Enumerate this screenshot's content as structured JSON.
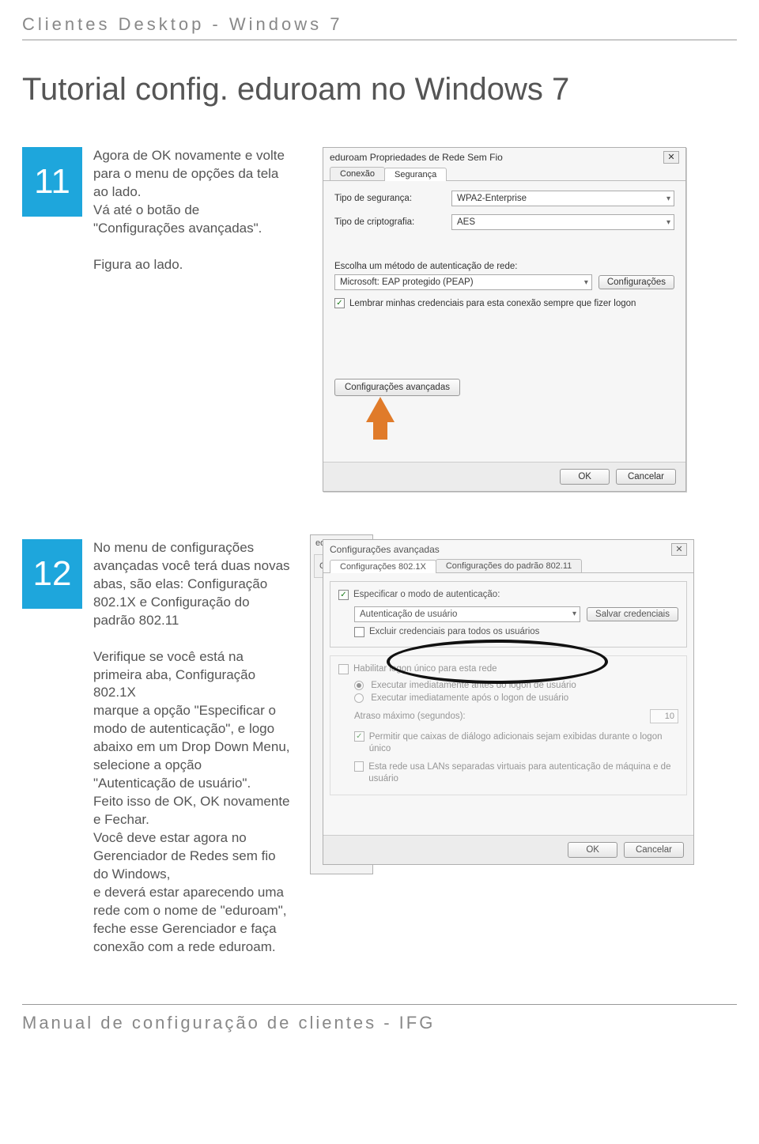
{
  "header": "Clientes Desktop - Windows 7",
  "title": "Tutorial config. eduroam no Windows 7",
  "step11": {
    "num": "11",
    "body": "Agora de OK novamente e volte para o menu de opções da tela ao lado.\nVá até o botão de \"Configurações avançadas\".\n\nFigura ao lado."
  },
  "dlg1": {
    "title": "eduroam Propriedades de Rede Sem Fio",
    "close": "✕",
    "tabs": {
      "conexao": "Conexão",
      "seguranca": "Segurança"
    },
    "tipo_seg_label": "Tipo de segurança:",
    "tipo_seg_value": "WPA2-Enterprise",
    "tipo_crip_label": "Tipo de criptografia:",
    "tipo_crip_value": "AES",
    "metodo_label": "Escolha um método de autenticação de rede:",
    "metodo_value": "Microsoft: EAP protegido (PEAP)",
    "config_btn": "Configurações",
    "lembrar": "Lembrar minhas credenciais para esta conexão sempre que fizer logon",
    "adv_btn": "Configurações avançadas",
    "ok": "OK",
    "cancel": "Cancelar"
  },
  "step12": {
    "num": "12",
    "body": "No menu de configurações avançadas você terá duas novas abas, são elas: Configuração 802.1X e Configuração do padrão 802.11\n\nVerifique se você está na primeira aba, Configuração 802.1X\nmarque a opção \"Especificar o modo de autenticação\", e logo abaixo em um Drop Down Menu, selecione a opção\n\"Autenticação de usuário\".\nFeito isso de OK, OK novamente e Fechar.\nVocê deve estar agora no Gerenciador de Redes sem fio do Windows,\ne deverá estar aparecendo uma rede com o nome de \"eduroam\",\nfeche esse Gerenciador e faça conexão com a rede eduroam."
  },
  "dlg2": {
    "behind_title": "edur",
    "behind_tab": "Configuraçã",
    "title": "Configurações avançadas",
    "tab1": "Configurações 802.1X",
    "tab2": "Configurações do padrão 802.11",
    "especificar": "Especificar o modo de autenticação:",
    "auth_value": "Autenticação de usuário",
    "salvar_cred": "Salvar credenciais",
    "excluir": "Excluir credenciais para todos os usuários",
    "habilitar": "Habilitar logon único para esta rede",
    "r1": "Executar imediatamente antes do logon de usuário",
    "r2": "Executar imediatamente após o logon de usuário",
    "atraso_label": "Atraso máximo (segundos):",
    "atraso_val": "10",
    "c1": "Permitir que caixas de diálogo adicionais sejam exibidas durante o logon único",
    "c2": "Esta rede usa LANs separadas virtuais para autenticação de máquina e de usuário",
    "ok": "OK",
    "cancel": "Cancelar"
  },
  "footer": "Manual de configuração de clientes - IFG"
}
